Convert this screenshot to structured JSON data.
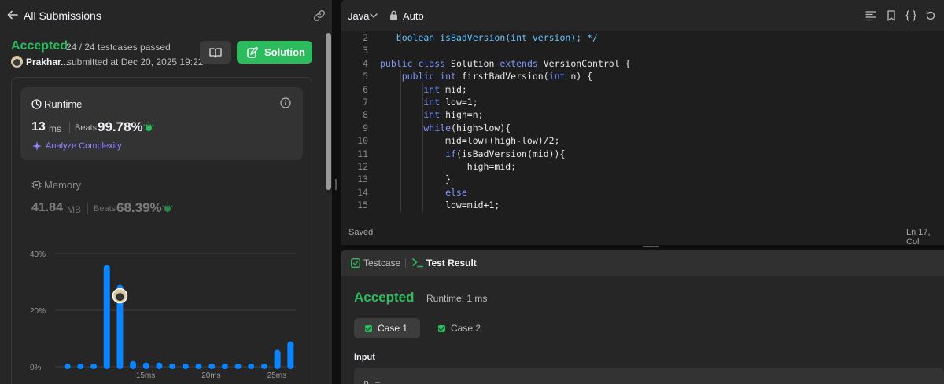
{
  "left_panel": {
    "header_title": "All Submissions",
    "status": "Accepted",
    "testcases": "24 / 24 testcases passed",
    "username": "Prakhar...",
    "submitted": "submitted at Dec 20, 2025 19:22",
    "solution_label": "Solution",
    "runtime": {
      "title": "Runtime",
      "value": "13",
      "unit": "ms",
      "beats_label": "Beats",
      "beats_pct": "99.78%",
      "analyze_label": "Analyze Complexity"
    },
    "memory": {
      "title": "Memory",
      "value": "41.84",
      "unit": "MB",
      "beats_label": "Beats",
      "beats_pct": "68.39%"
    }
  },
  "chart_data": {
    "type": "bar",
    "y_tick_labels": [
      "40%",
      "20%",
      "0%"
    ],
    "y_ticks": [
      40,
      20,
      0
    ],
    "ylim": [
      0,
      40
    ],
    "x_tick_labels": [
      "15ms",
      "20ms",
      "25ms"
    ],
    "x": [
      9,
      10,
      11,
      12,
      13,
      14,
      15,
      16,
      17,
      18,
      19,
      20,
      21,
      22,
      23,
      24,
      25,
      26
    ],
    "values": [
      1,
      1,
      1,
      36,
      29,
      2,
      1.5,
      1.5,
      1,
      1,
      1,
      1,
      1,
      1,
      1,
      1,
      6,
      9
    ],
    "highlight_x": 13,
    "bar_color": "#0a84ff",
    "highlight_color": "#0a84ff"
  },
  "editor": {
    "language": "Java",
    "mode": "Auto",
    "status": "Saved",
    "cursor": "Ln 17, Col",
    "lines": [
      {
        "n": "2",
        "indent": 1,
        "tokens": [
          {
            "t": "   boolean isBadVersion(int version); */",
            "c": "cm"
          }
        ]
      },
      {
        "n": "3",
        "indent": 0,
        "tokens": []
      },
      {
        "n": "4",
        "indent": 0,
        "tokens": [
          {
            "t": "public class ",
            "c": "kw"
          },
          {
            "t": "Solution ",
            "c": "ident"
          },
          {
            "t": "extends ",
            "c": "kw"
          },
          {
            "t": "VersionControl {",
            "c": "ident"
          }
        ]
      },
      {
        "n": "5",
        "indent": 1,
        "tokens": [
          {
            "t": "    public int ",
            "c": "kw"
          },
          {
            "t": "firstBadVersion(",
            "c": "ident"
          },
          {
            "t": "int ",
            "c": "kw"
          },
          {
            "t": "n) {",
            "c": "ident"
          }
        ]
      },
      {
        "n": "6",
        "indent": 2,
        "tokens": [
          {
            "t": "        int ",
            "c": "kw"
          },
          {
            "t": "mid;",
            "c": "ident"
          }
        ]
      },
      {
        "n": "7",
        "indent": 2,
        "tokens": [
          {
            "t": "        int ",
            "c": "kw"
          },
          {
            "t": "low=1;",
            "c": "ident"
          }
        ]
      },
      {
        "n": "8",
        "indent": 2,
        "tokens": [
          {
            "t": "        int ",
            "c": "kw"
          },
          {
            "t": "high=n;",
            "c": "ident"
          }
        ]
      },
      {
        "n": "9",
        "indent": 2,
        "tokens": [
          {
            "t": "        while",
            "c": "kw"
          },
          {
            "t": "(high>low){",
            "c": "ident"
          }
        ]
      },
      {
        "n": "10",
        "indent": 3,
        "tokens": [
          {
            "t": "            mid=low+(high-low)/2;",
            "c": "ident"
          }
        ]
      },
      {
        "n": "11",
        "indent": 3,
        "tokens": [
          {
            "t": "            if",
            "c": "kw"
          },
          {
            "t": "(isBadVersion(mid)){",
            "c": "ident"
          }
        ]
      },
      {
        "n": "12",
        "indent": 4,
        "tokens": [
          {
            "t": "                high=mid;",
            "c": "ident"
          }
        ]
      },
      {
        "n": "13",
        "indent": 3,
        "tokens": [
          {
            "t": "            }",
            "c": "ident"
          }
        ]
      },
      {
        "n": "14",
        "indent": 3,
        "tokens": [
          {
            "t": "            else",
            "c": "kw"
          }
        ]
      },
      {
        "n": "15",
        "indent": 3,
        "tokens": [
          {
            "t": "            low=mid+1;",
            "c": "ident"
          }
        ]
      }
    ]
  },
  "result_panel": {
    "tab_testcase": "Testcase",
    "tab_result": "Test Result",
    "status": "Accepted",
    "runtime": "Runtime: 1 ms",
    "case1": "Case 1",
    "case2": "Case 2",
    "input_label": "Input",
    "input_value": "n ="
  }
}
